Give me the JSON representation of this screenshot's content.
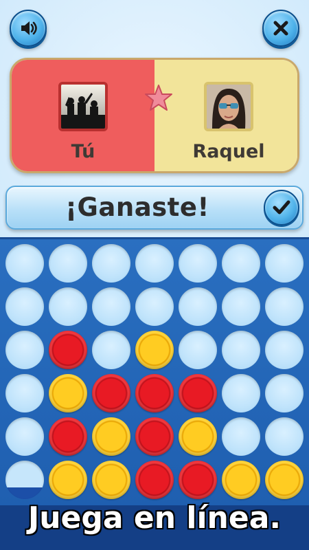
{
  "header": {
    "sound_icon": "speaker-icon",
    "close_icon": "close-icon"
  },
  "players": {
    "left": {
      "name": "Tú",
      "color": "#ef5d5d",
      "avatar": "concert-crowd-photo"
    },
    "right": {
      "name": "Raquel",
      "color": "#f2e49a",
      "avatar": "woman-sunglasses-photo"
    },
    "turn_icon": "star-icon"
  },
  "result": {
    "text": "¡Ganaste!",
    "button_icon": "checkmark-icon"
  },
  "board": {
    "rows": [
      [
        "empty",
        "empty",
        "empty",
        "empty",
        "empty",
        "empty",
        "empty"
      ],
      [
        "empty",
        "empty",
        "empty",
        "empty",
        "empty",
        "empty",
        "empty"
      ],
      [
        "empty",
        "red",
        "empty",
        "yellow",
        "empty",
        "empty",
        "empty"
      ],
      [
        "empty",
        "yellow",
        "red",
        "red",
        "red",
        "empty",
        "empty"
      ],
      [
        "empty",
        "red",
        "yellow",
        "red",
        "yellow",
        "empty",
        "empty"
      ],
      [
        "partial",
        "yellow",
        "yellow",
        "red",
        "red",
        "yellow",
        "yellow"
      ]
    ],
    "colors": {
      "red": "#e81a24",
      "yellow": "#ffcc22",
      "board": "#1f5fb0"
    }
  },
  "caption": {
    "text": "Juega en línea."
  }
}
